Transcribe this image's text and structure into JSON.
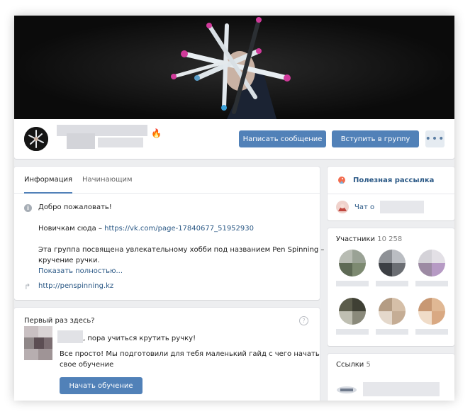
{
  "header": {
    "group_emoji": "🔥",
    "message_button": "Написать сообщение",
    "join_button": "Вступить в группу",
    "more_button": "•••"
  },
  "info": {
    "tabs": [
      "Информация",
      "Начинающим"
    ],
    "welcome": "Добро пожаловать!",
    "newbies_prefix": "Новичкам сюда – ",
    "newbies_link": "https://vk.com/page-17840677_51952930",
    "description_line1": "Эта группа посвящена увлекательному хобби под названием Pen Spinning –",
    "description_line2": "кручение ручки.",
    "show_more": "Показать полностью...",
    "site_link": "http://penspinning.kz"
  },
  "first_time": {
    "title": "Первый раз здесь?",
    "help": "?",
    "greeting_suffix": ", пора учиться крутить ручку!",
    "text_line1": "Все просто! Мы подготовили для тебя маленький гайд с чего начать",
    "text_line2": "свое обучение",
    "start_button": "Начать обучение"
  },
  "sidebar": {
    "newsletter": "Полезная рассылка",
    "chat_prefix": "Чат о",
    "members_title": "Участники",
    "members_count": "10 258",
    "links_title": "Ссылки",
    "links_count": "5"
  },
  "colors": {
    "accent": "#5181b8",
    "link": "#2a5885",
    "background": "#edeef0"
  }
}
